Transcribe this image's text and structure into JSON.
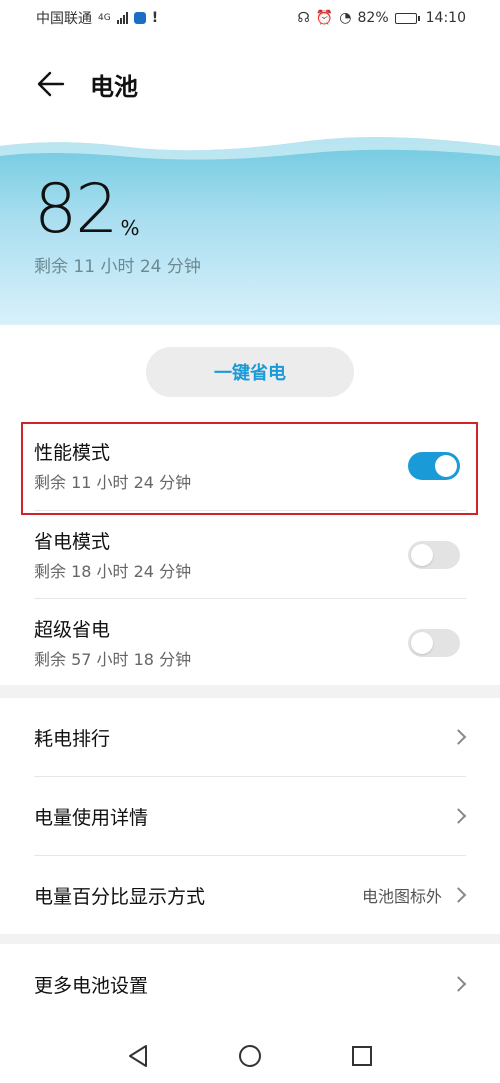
{
  "status_bar": {
    "carrier": "中国联通",
    "network": "4G",
    "battery_percent": "82%",
    "time": "14:10",
    "battery_level": 0.82
  },
  "header": {
    "title": "电池",
    "back_icon": "arrow-left-icon"
  },
  "hero": {
    "percent": "82",
    "percent_sign": "%",
    "remaining": "剩余 11 小时 24 分钟",
    "gradient_colors": [
      "#6cc8de",
      "#d9f1fa"
    ]
  },
  "one_key_save": {
    "label": "一键省电",
    "color": "#1a9bd7"
  },
  "modes": [
    {
      "title": "性能模式",
      "subtitle": "剩余 11 小时 24 分钟",
      "enabled": true
    },
    {
      "title": "省电模式",
      "subtitle": "剩余 18 小时 24 分钟",
      "enabled": false
    },
    {
      "title": "超级省电",
      "subtitle": "剩余 57 小时 18 分钟",
      "enabled": false
    }
  ],
  "list": {
    "items": [
      {
        "label": "耗电排行",
        "value": ""
      },
      {
        "label": "电量使用详情",
        "value": ""
      },
      {
        "label": "电量百分比显示方式",
        "value": "电池图标外"
      }
    ]
  },
  "more": {
    "label": "更多电池设置"
  },
  "colors": {
    "accent": "#1a9bd7",
    "highlight": "#d0242b"
  },
  "nav": {
    "icons": [
      "back-triangle-icon",
      "home-circle-icon",
      "recents-square-icon"
    ]
  }
}
